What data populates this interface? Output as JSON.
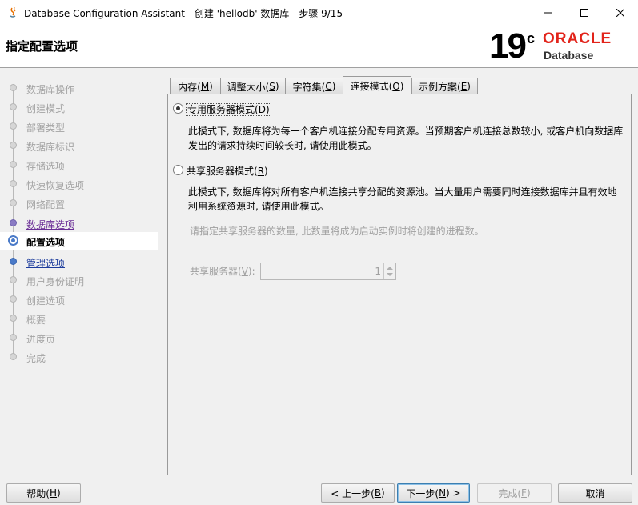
{
  "window": {
    "title": "Database Configuration Assistant - 创建 'hellodb' 数据库 - 步骤 9/15"
  },
  "header": {
    "title": "指定配置选项",
    "logo_version": "19",
    "logo_suffix": "c",
    "logo_brand": "ORACLE",
    "logo_product": "Database"
  },
  "nav": {
    "items": [
      {
        "label": "数据库操作",
        "state": "disabled"
      },
      {
        "label": "创建模式",
        "state": "disabled"
      },
      {
        "label": "部署类型",
        "state": "disabled"
      },
      {
        "label": "数据库标识",
        "state": "disabled"
      },
      {
        "label": "存储选项",
        "state": "disabled"
      },
      {
        "label": "快速恢复选项",
        "state": "disabled"
      },
      {
        "label": "网络配置",
        "state": "disabled"
      },
      {
        "label": "数据库选项",
        "state": "visited"
      },
      {
        "label": "配置选项",
        "state": "current"
      },
      {
        "label": "管理选项",
        "state": "link"
      },
      {
        "label": "用户身份证明",
        "state": "disabled"
      },
      {
        "label": "创建选项",
        "state": "disabled"
      },
      {
        "label": "概要",
        "state": "disabled"
      },
      {
        "label": "进度页",
        "state": "disabled"
      },
      {
        "label": "完成",
        "state": "disabled"
      }
    ]
  },
  "tabs": [
    {
      "label": "内存(",
      "mnemonic": "M",
      "end": ")"
    },
    {
      "label": "调整大小(",
      "mnemonic": "S",
      "end": ")"
    },
    {
      "label": "字符集(",
      "mnemonic": "C",
      "end": ")"
    },
    {
      "label": "连接模式(",
      "mnemonic": "O",
      "end": ")"
    },
    {
      "label": "示例方案(",
      "mnemonic": "E",
      "end": ")"
    }
  ],
  "connection_mode": {
    "dedicated": {
      "label": "专用服务器模式(",
      "mnemonic": "D",
      "end": ")",
      "checked": true,
      "desc_line1": "此模式下, 数据库将为每一个客户机连接分配专用资源。当预期客户机连接总数较小, 或客户机向数据库",
      "desc_line2": "发出的请求持续时间较长时, 请使用此模式。"
    },
    "shared": {
      "label": "共享服务器模式(",
      "mnemonic": "R",
      "end": ")",
      "checked": false,
      "desc_line1": "此模式下, 数据库将对所有客户机连接共享分配的资源池。当大量用户需要同时连接数据库并且有效地",
      "desc_line2": "利用系统资源时, 请使用此模式。",
      "hint": "请指定共享服务器的数量, 此数量将成为启动实例时将创建的进程数。",
      "count_label": "共享服务器(",
      "count_mnemonic": "V",
      "count_end": "):",
      "count_value": "1"
    }
  },
  "buttons": {
    "help": {
      "label": "帮助(",
      "mnemonic": "H",
      "end": ")"
    },
    "back": {
      "label": "< 上一步(",
      "mnemonic": "B",
      "end": ")"
    },
    "next": {
      "label": "下一步(",
      "mnemonic": "N",
      "end": ") >"
    },
    "finish": {
      "label": "完成(",
      "mnemonic": "F",
      "end": ")"
    },
    "cancel": {
      "label": "取消"
    }
  }
}
